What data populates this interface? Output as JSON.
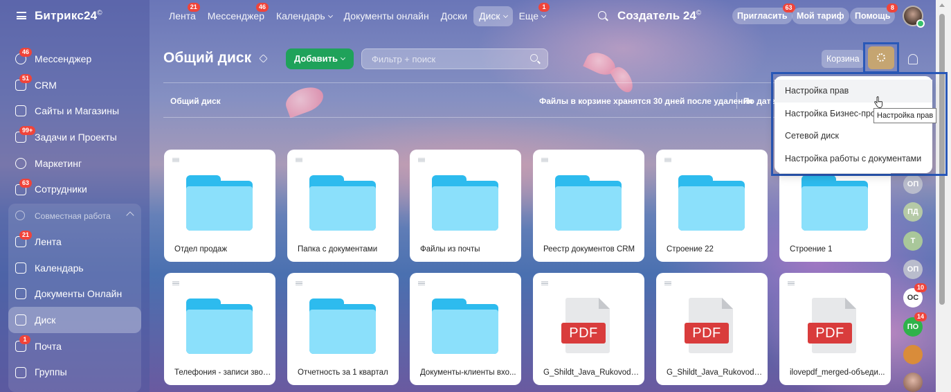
{
  "app": {
    "logo": "Битрикс24",
    "logo_mark": "©"
  },
  "sidebar": {
    "items": [
      {
        "label": "Мессенджер",
        "badge": "46",
        "icon": "messenger-icon"
      },
      {
        "label": "CRM",
        "badge": "51",
        "icon": "crm-icon"
      },
      {
        "label": "Сайты и Магазины",
        "badge": "",
        "icon": "cart-icon"
      },
      {
        "label": "Задачи и Проекты",
        "badge": "99+",
        "icon": "tasks-icon"
      },
      {
        "label": "Маркетинг",
        "badge": "",
        "icon": "marketing-icon"
      },
      {
        "label": "Сотрудники",
        "badge": "63",
        "icon": "employees-icon"
      }
    ],
    "group_title": "Совместная работа",
    "group_items": [
      {
        "label": "Лента",
        "badge": "21",
        "icon": "feed-icon"
      },
      {
        "label": "Календарь",
        "badge": "",
        "icon": "calendar-icon"
      },
      {
        "label": "Документы Онлайн",
        "badge": "",
        "icon": "documents-icon"
      },
      {
        "label": "Диск",
        "badge": "",
        "icon": "disk-icon",
        "active": true
      },
      {
        "label": "Почта",
        "badge": "1",
        "icon": "mail-icon"
      },
      {
        "label": "Группы",
        "badge": "",
        "icon": "groups-icon"
      }
    ]
  },
  "topbar": {
    "nav": [
      {
        "label": "Лента",
        "badge": "21"
      },
      {
        "label": "Мессенджер",
        "badge": "46"
      },
      {
        "label": "Календарь",
        "badge": "",
        "dropdown": true
      },
      {
        "label": "Документы онлайн",
        "badge": ""
      },
      {
        "label": "Доски",
        "badge": ""
      },
      {
        "label": "Диск",
        "badge": "",
        "dropdown": true,
        "active": true
      },
      {
        "label": "Еще",
        "badge": "1",
        "dropdown": true
      }
    ],
    "company": "Создатель 24",
    "company_mark": "©",
    "invite": {
      "label": "Пригласить",
      "badge": "63"
    },
    "tariff": {
      "label": "Мой тариф"
    },
    "help": {
      "label": "Помощь",
      "badge": "8"
    }
  },
  "header": {
    "title": "Общий диск",
    "add_button": "Добавить",
    "filter_placeholder": "Фильтр + поиск",
    "trash_button": "Корзина"
  },
  "breadcrumb": {
    "current": "Общий диск",
    "trash_note": "Файлы в корзине хранятся 30 дней после удаления",
    "sort_label": "По дате"
  },
  "files": [
    {
      "name": "Отдел продаж",
      "type": "folder"
    },
    {
      "name": "Папка с документами",
      "type": "folder"
    },
    {
      "name": "Файлы из почты",
      "type": "folder"
    },
    {
      "name": "Реестр документов CRM",
      "type": "folder"
    },
    {
      "name": "Строение 22",
      "type": "folder"
    },
    {
      "name": "Строение 1",
      "type": "folder"
    },
    {
      "name": "Телефония - записи звон...",
      "type": "folder"
    },
    {
      "name": "Отчетность за 1 квартал",
      "type": "folder"
    },
    {
      "name": "Документы-клиенты вхо...",
      "type": "folder"
    },
    {
      "name": "G_Shildt_Java_Rukovodstv...",
      "type": "pdf"
    },
    {
      "name": "G_Shildt_Java_Rukovodstv...",
      "type": "pdf"
    },
    {
      "name": "ilovepdf_merged-объеди...",
      "type": "pdf"
    }
  ],
  "pdf_label": "PDF",
  "settings_menu": {
    "items": [
      "Настройка прав",
      "Настройка Бизнес-процессов",
      "Сетевой диск",
      "Настройка работы с документами"
    ],
    "tooltip": "Настройка прав"
  },
  "rail": [
    {
      "initials": "ОП",
      "badge": "",
      "color": "#b9bccc"
    },
    {
      "initials": "ПД",
      "badge": "",
      "color": "#b5c9a6"
    },
    {
      "initials": "Т",
      "badge": "",
      "color": "#a9c79a"
    },
    {
      "initials": "ОП",
      "badge": "",
      "color": "#b9bccc"
    },
    {
      "initials": "ОС",
      "badge": "10",
      "color": "#ffffff"
    },
    {
      "initials": "ПО",
      "badge": "14",
      "color": "#2fb24a"
    }
  ],
  "colors": {
    "accent": "#1fa25a",
    "folder": "#2dbbee",
    "pdf": "#d93c3c",
    "badge": "#f0443a"
  }
}
